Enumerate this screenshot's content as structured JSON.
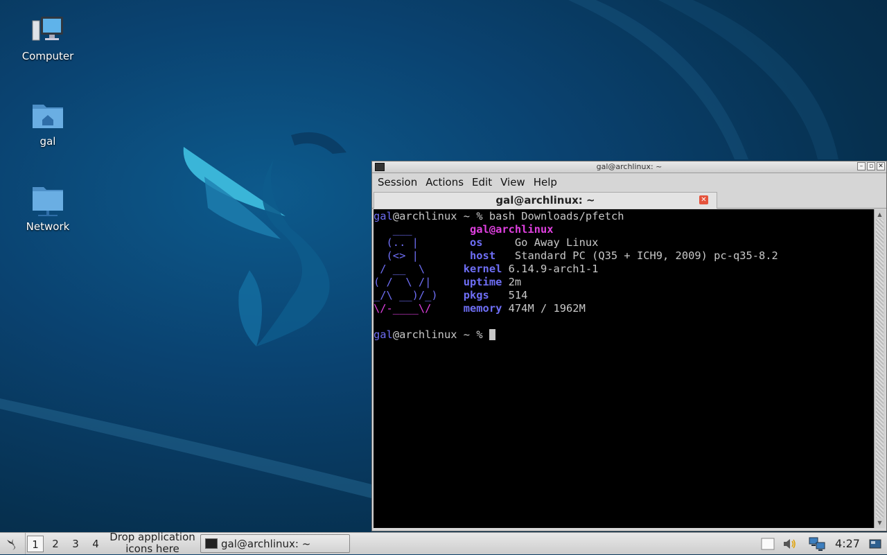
{
  "desktop": {
    "icons": [
      {
        "label": "Computer",
        "icon": "computer-icon"
      },
      {
        "label": "gal",
        "icon": "home-folder-icon"
      },
      {
        "label": "Network",
        "icon": "network-folder-icon"
      }
    ]
  },
  "window": {
    "title": "gal@archlinux: ~",
    "menu": [
      "Session",
      "Actions",
      "Edit",
      "View",
      "Help"
    ],
    "tab_title": "gal@archlinux: ~"
  },
  "terminal": {
    "user": "gal",
    "host": "@archlinux",
    "path": "~",
    "prompt_symbol": "%",
    "command": "bash Downloads/pfetch",
    "pfetch": {
      "title": "gal@archlinux",
      "os_label": "os",
      "os_value": "Go Away Linux",
      "host_label": "host",
      "host_value": "Standard PC (Q35 + ICH9, 2009) pc-q35-8.2",
      "kernel_label": "kernel",
      "kernel_value": "6.14.9-arch1-1",
      "uptime_label": "uptime",
      "uptime_value": "2m",
      "pkgs_label": "pkgs",
      "pkgs_value": "514",
      "memory_label": "memory",
      "memory_value": "474M / 1962M"
    },
    "ascii": [
      "   ___   ",
      "  (.. |  ",
      "  (<> |  ",
      " / __  \\ ",
      "( /  \\ /|",
      "_/\\ __)/_)",
      "\\/-____\\/"
    ]
  },
  "taskbar": {
    "workspaces": [
      "1",
      "2",
      "3",
      "4"
    ],
    "active_workspace": "1",
    "drop_text_1": "Drop application",
    "drop_text_2": "icons here",
    "task_title": "gal@archlinux: ~",
    "clock": "4:27"
  }
}
